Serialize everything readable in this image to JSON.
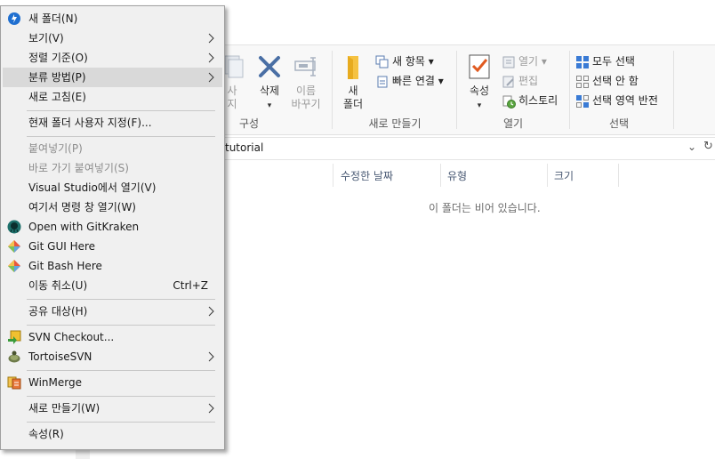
{
  "ribbon": {
    "organize": {
      "copy_to_partial": "사",
      "copy_to_partial2": "지",
      "delete_label": "삭제",
      "rename_label": "이름\n바꾸기",
      "title": "구성"
    },
    "new": {
      "new_folder_label": "새\n폴더",
      "new_item_label": "새 항목 ▾",
      "easy_access_label": "빠른 연결 ▾",
      "title": "새로 만들기"
    },
    "open": {
      "properties_label": "속성",
      "open_label": "열기 ▾",
      "edit_label": "편집",
      "history_label": "히스토리",
      "title": "열기"
    },
    "select": {
      "select_all_label": "모두 선택",
      "select_none_label": "선택 안 함",
      "invert_label": "선택 영역 반전",
      "title": "선택"
    }
  },
  "address": {
    "path_partial": "tutorial"
  },
  "columns": [
    "수정한 날짜",
    "유형",
    "크기"
  ],
  "empty_message": "이 폴더는 비어 있습니다.",
  "context_menu": {
    "items": [
      {
        "label": "새 폴더(N)"
      },
      {
        "label": "보기(V)"
      },
      {
        "label": "정렬 기준(O)"
      },
      {
        "label": "분류 방법(P)"
      },
      {
        "label": "새로 고침(E)"
      },
      {
        "label": "현재 폴더 사용자 지정(F)..."
      },
      {
        "label": "붙여넣기(P)"
      },
      {
        "label": "바로 가기 붙여넣기(S)"
      },
      {
        "label": "Visual Studio에서 열기(V)"
      },
      {
        "label": "여기서 명령 창 열기(W)"
      },
      {
        "label": "Open with GitKraken"
      },
      {
        "label": "Git GUI Here"
      },
      {
        "label": "Git Bash Here"
      },
      {
        "label": "이동 취소(U)",
        "shortcut": "Ctrl+Z"
      },
      {
        "label": "공유 대상(H)"
      },
      {
        "label": "SVN Checkout..."
      },
      {
        "label": "TortoiseSVN"
      },
      {
        "label": "WinMerge"
      },
      {
        "label": "새로 만들기(W)"
      },
      {
        "label": "속성(R)"
      }
    ]
  },
  "colors": {
    "menu_bg": "#f0f0f0",
    "highlight": "#d9d9d9",
    "accent_blue": "#0078d7"
  }
}
